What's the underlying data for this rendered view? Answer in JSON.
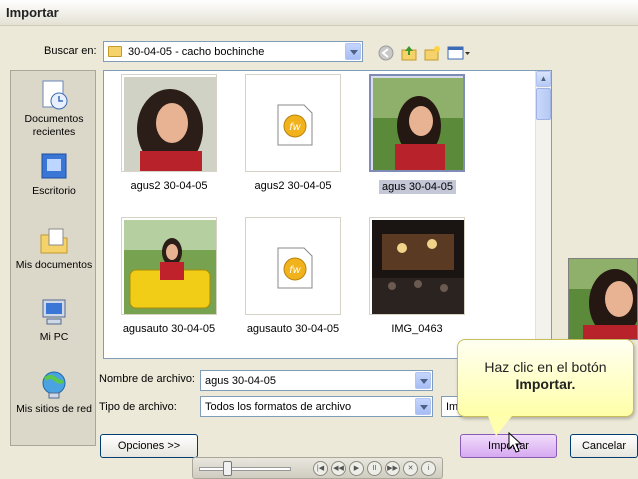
{
  "window": {
    "title": "Importar"
  },
  "lookin": {
    "label": "Buscar en:",
    "value": "30-04-05 - cacho bochinche"
  },
  "toolbar": {
    "icons": [
      "back-icon",
      "up-folder-icon",
      "new-folder-icon",
      "view-menu-icon"
    ]
  },
  "places": [
    {
      "label": "Documentos recientes",
      "icon": "recent-documents-icon"
    },
    {
      "label": "Escritorio",
      "icon": "desktop-icon"
    },
    {
      "label": "Mis documentos",
      "icon": "my-documents-icon"
    },
    {
      "label": "Mi PC",
      "icon": "my-computer-icon"
    },
    {
      "label": "Mis sitios de red",
      "icon": "network-places-icon"
    }
  ],
  "files": [
    {
      "name": "agus2 30-04-05",
      "kind": "photo",
      "selected": false
    },
    {
      "name": "agus2 30-04-05",
      "kind": "flash",
      "selected": false
    },
    {
      "name": "agus 30-04-05",
      "kind": "photo",
      "selected": true
    },
    {
      "name": "agusauto 30-04-05",
      "kind": "photo",
      "selected": false
    },
    {
      "name": "agusauto 30-04-05",
      "kind": "flash",
      "selected": false
    },
    {
      "name": "IMG_0463",
      "kind": "photo",
      "selected": false
    }
  ],
  "filename": {
    "label": "Nombre de archivo:",
    "value": "agus 30-04-05"
  },
  "filetype": {
    "label": "Tipo de archivo:",
    "value": "Todos los formatos de archivo",
    "extra_value": "Ima"
  },
  "buttons": {
    "options": "Opciones >>",
    "import": "Importar",
    "cancel": "Cancelar"
  },
  "callout": {
    "line1": "Haz clic en el botón",
    "line2": "Importar."
  },
  "colors": {
    "selection": "#c3c7d6",
    "import_button": "#d6a9f0",
    "callout": "#ffffa8",
    "accent_border": "#7f9db9"
  }
}
